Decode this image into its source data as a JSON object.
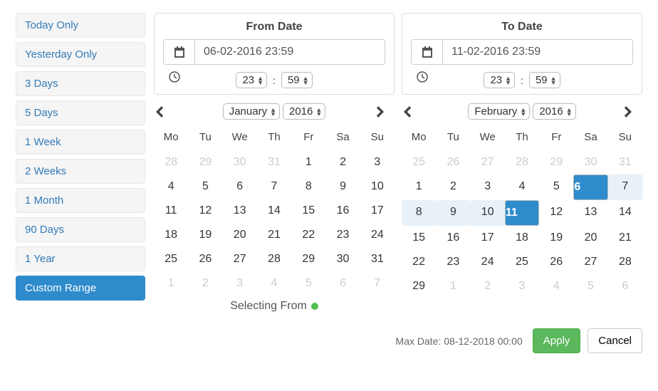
{
  "presets": [
    "Today Only",
    "Yesterday Only",
    "3 Days",
    "5 Days",
    "1 Week",
    "2 Weeks",
    "1 Month",
    "90 Days",
    "1 Year",
    "Custom Range"
  ],
  "active_preset_index": 9,
  "from": {
    "title": "From Date",
    "date_value": "06-02-2016 23:59",
    "hour": "23",
    "minute": "59",
    "month": "January",
    "year": "2016",
    "selected_day": null,
    "range_days": []
  },
  "to": {
    "title": "To Date",
    "date_value": "11-02-2016 23:59",
    "hour": "23",
    "minute": "59",
    "month": "February",
    "year": "2016",
    "selected_day": 11,
    "highlight_day": 6,
    "range_days": [
      7,
      8,
      9,
      10
    ]
  },
  "dow": [
    "Mo",
    "Tu",
    "We",
    "Th",
    "Fr",
    "Sa",
    "Su"
  ],
  "cal_from": {
    "leading_muted": [
      28,
      29,
      30,
      31
    ],
    "days": [
      1,
      2,
      3,
      4,
      5,
      6,
      7,
      8,
      9,
      10,
      11,
      12,
      13,
      14,
      15,
      16,
      17,
      18,
      19,
      20,
      21,
      22,
      23,
      24,
      25,
      26,
      27,
      28,
      29,
      30,
      31
    ],
    "trailing_muted": [
      1,
      2,
      3,
      4,
      5,
      6,
      7
    ]
  },
  "cal_to": {
    "leading_muted": [
      25,
      26,
      27,
      28,
      29,
      30,
      31
    ],
    "days": [
      1,
      2,
      3,
      4,
      5,
      6,
      7,
      8,
      9,
      10,
      11,
      12,
      13,
      14,
      15,
      16,
      17,
      18,
      19,
      20,
      21,
      22,
      23,
      24,
      25,
      26,
      27,
      28,
      29
    ],
    "trailing_muted": [
      1,
      2,
      3,
      4,
      5,
      6
    ]
  },
  "status": "Selecting From",
  "max_date_label": "Max Date: 08-12-2018 00:00",
  "apply_label": "Apply",
  "cancel_label": "Cancel",
  "colon": ":"
}
